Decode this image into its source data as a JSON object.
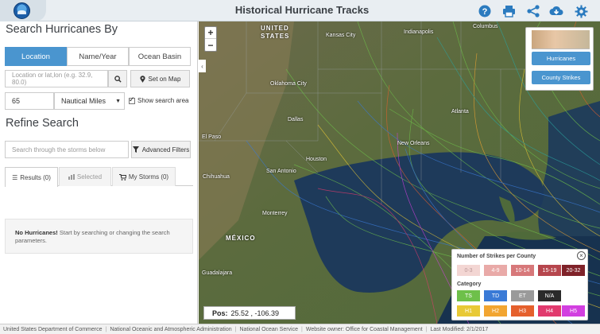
{
  "header": {
    "title": "Historical Hurricane Tracks",
    "brand_color": "#2b7bbf",
    "icons": [
      "help-icon",
      "print-icon",
      "share-icon",
      "download-icon",
      "settings-icon"
    ]
  },
  "sidebar": {
    "search_heading": "Search Hurricanes By",
    "search_tabs": [
      {
        "label": "Location",
        "active": true
      },
      {
        "label": "Name/Year",
        "active": false
      },
      {
        "label": "Ocean Basin",
        "active": false
      }
    ],
    "location_placeholder": "Location or lat,lon (e.g. 32.9, 80.0)",
    "set_on_map_label": "Set on Map",
    "radius_value": "65",
    "units_selected": "Nautical Miles",
    "show_search_area_label": "Show search area",
    "refine_heading": "Refine Search",
    "filter_placeholder": "Search through the storms below",
    "advanced_filters_label": "Advanced Filters",
    "result_tabs": [
      {
        "label": "Results (0)"
      },
      {
        "label": "Selected"
      },
      {
        "label": "My Storms (0)"
      }
    ],
    "no_results_bold": "No Hurricanes!",
    "no_results_text": "Start by searching or changing the search parameters."
  },
  "map": {
    "zoom_in": "+",
    "zoom_out": "−",
    "collapse_arrow": "‹",
    "pos_label": "Pos:",
    "pos_value": "25.52 , -106.39",
    "labels": [
      {
        "text": "UNITED",
        "cls": "big"
      },
      {
        "text": "STATES",
        "cls": "big"
      },
      {
        "text": "MÉXICO",
        "cls": "big"
      },
      {
        "text": "Kansas City"
      },
      {
        "text": "Indianapolis"
      },
      {
        "text": "Columbus"
      },
      {
        "text": "Oklahoma City"
      },
      {
        "text": "Dallas"
      },
      {
        "text": "Houston"
      },
      {
        "text": "San Antonio"
      },
      {
        "text": "Monterrey"
      },
      {
        "text": "Chihuahua"
      },
      {
        "text": "Atlanta"
      },
      {
        "text": "New Orleans"
      },
      {
        "text": "El Paso"
      },
      {
        "text": "Guadalajara"
      }
    ]
  },
  "layer_panel": {
    "hurricanes_label": "Hurricanes",
    "county_strikes_label": "County Strikes"
  },
  "legend": {
    "strikes_title": "Number of Strikes per County",
    "strike_bins": [
      {
        "label": "0-3",
        "color": "#f3d6d3"
      },
      {
        "label": "4-9",
        "color": "#e9aaa8"
      },
      {
        "label": "10-14",
        "color": "#d7787a"
      },
      {
        "label": "15-19",
        "color": "#b6464d"
      },
      {
        "label": "20-32",
        "color": "#7f2229"
      }
    ],
    "category_title": "Category",
    "categories": [
      {
        "label": "TS",
        "color": "#6ec04a"
      },
      {
        "label": "TD",
        "color": "#3a7ad6"
      },
      {
        "label": "ET",
        "color": "#9a9a9a"
      },
      {
        "label": "N/A",
        "color": "#2a2a2a"
      },
      {
        "label": "H1",
        "color": "#e8c935"
      },
      {
        "label": "H2",
        "color": "#f2a531"
      },
      {
        "label": "H3",
        "color": "#e5602c"
      },
      {
        "label": "H4",
        "color": "#e13a6d"
      },
      {
        "label": "H5",
        "color": "#d23fe0"
      }
    ]
  },
  "footer": {
    "items": [
      "United States Department of Commerce",
      "National Oceanic and Atmospheric Administration",
      "National Ocean Service",
      "Website owner: Office for Coastal Management",
      "Last Modified: 2/1/2017"
    ]
  }
}
